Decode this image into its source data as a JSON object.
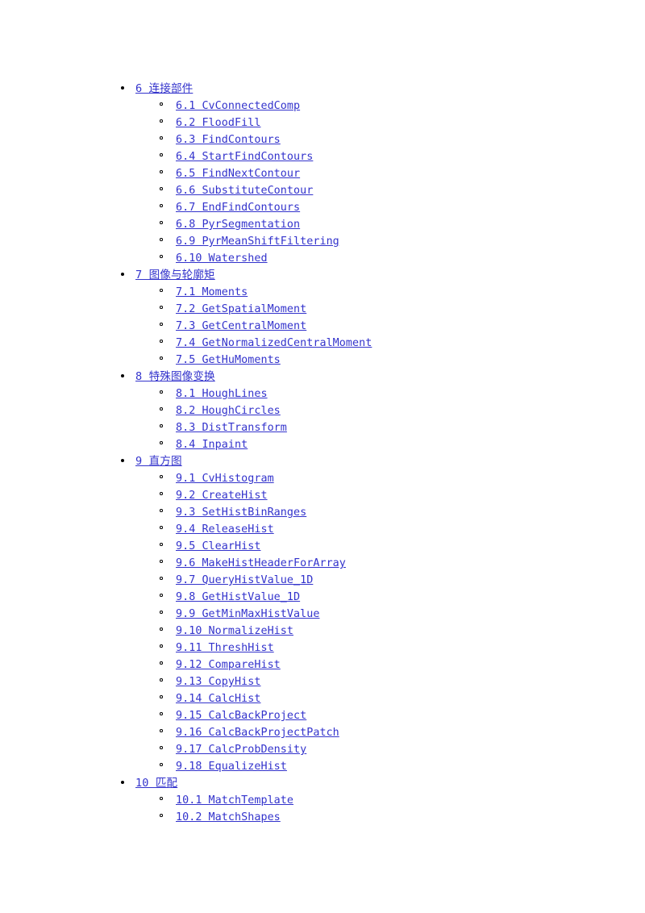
{
  "document": {
    "background_color": "#ffffff",
    "link_color": "#3333cc",
    "bullet_color": "#000000",
    "type": "table-of-contents"
  },
  "toc": {
    "sections": [
      {
        "heading": "6 连接部件",
        "items": [
          "6.1 CvConnectedComp",
          "6.2 FloodFill",
          "6.3 FindContours",
          "6.4 StartFindContours",
          "6.5 FindNextContour",
          "6.6 SubstituteContour",
          "6.7 EndFindContours",
          "6.8 PyrSegmentation",
          "6.9 PyrMeanShiftFiltering",
          "6.10 Watershed"
        ]
      },
      {
        "heading": "7 图像与轮廓矩",
        "items": [
          "7.1 Moments",
          "7.2 GetSpatialMoment",
          "7.3 GetCentralMoment",
          "7.4 GetNormalizedCentralMoment",
          "7.5 GetHuMoments"
        ]
      },
      {
        "heading": "8 特殊图像变换",
        "items": [
          "8.1 HoughLines",
          "8.2 HoughCircles",
          "8.3 DistTransform",
          "8.4 Inpaint"
        ]
      },
      {
        "heading": "9 直方图",
        "items": [
          "9.1 CvHistogram",
          "9.2 CreateHist",
          "9.3 SetHistBinRanges",
          "9.4 ReleaseHist",
          "9.5 ClearHist",
          "9.6 MakeHistHeaderForArray",
          "9.7 QueryHistValue_1D",
          "9.8 GetHistValue_1D",
          "9.9 GetMinMaxHistValue",
          "9.10 NormalizeHist",
          "9.11 ThreshHist",
          "9.12 CompareHist",
          "9.13 CopyHist",
          "9.14 CalcHist",
          "9.15 CalcBackProject",
          "9.16 CalcBackProjectPatch",
          "9.17 CalcProbDensity",
          "9.18 EqualizeHist"
        ]
      },
      {
        "heading": "10 匹配",
        "items": [
          "10.1 MatchTemplate",
          "10.2 MatchShapes"
        ]
      }
    ]
  }
}
